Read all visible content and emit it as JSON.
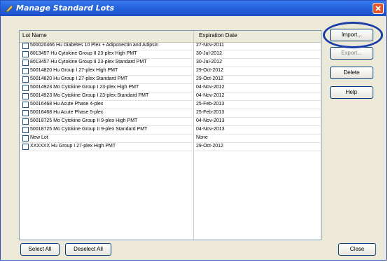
{
  "window": {
    "title": "Manage Standard Lots"
  },
  "list": {
    "headers": {
      "lot_name": "Lot Name",
      "expiration_date": "Expiration Date"
    },
    "rows": [
      {
        "name": "500020466 Hu Diabetes 10 Plex + Adiponectin and Adipsin",
        "date": "27-Nov-2011"
      },
      {
        "name": "8013457 Hu Cytokine Group II 23-plex High PMT",
        "date": "30-Jul-2012"
      },
      {
        "name": "8013457 Hu Cytokine Group II 23-plex Standard PMT",
        "date": "30-Jul-2012"
      },
      {
        "name": "50014820 Hu Group I 27-plex High PMT",
        "date": "29-Oct-2012"
      },
      {
        "name": "50014820 Hu Group I 27-plex Standard PMT",
        "date": "29-Oct-2012"
      },
      {
        "name": "50014923 Mo Cytokine Group I 23-plex High PMT",
        "date": "04-Nov-2012"
      },
      {
        "name": "50014923 Mo Cytokine Group I 23-plex Standard PMT",
        "date": "04-Nov-2012"
      },
      {
        "name": "50016468 Hu Acute Phase 4-plex",
        "date": "25-Feb-2013"
      },
      {
        "name": "50016468 Hu Acute Phase 5-plex",
        "date": "25-Feb-2013"
      },
      {
        "name": "50018725 Mo Cytokine Group II 9-plex High PMT",
        "date": "04-Nov-2013"
      },
      {
        "name": "50018725 Mo Cytokine Group II 9-plex Standard PMT",
        "date": "04-Nov-2013"
      },
      {
        "name": "New Lot",
        "date": "None"
      },
      {
        "name": "XXXXXX Hu Group I 27-plex High PMT",
        "date": "29-Oct-2012"
      }
    ]
  },
  "buttons": {
    "import": "Import...",
    "export": "Export...",
    "delete": "Delete",
    "help": "Help",
    "select_all": "Select All",
    "deselect_all": "Deselect All",
    "close": "Close"
  }
}
